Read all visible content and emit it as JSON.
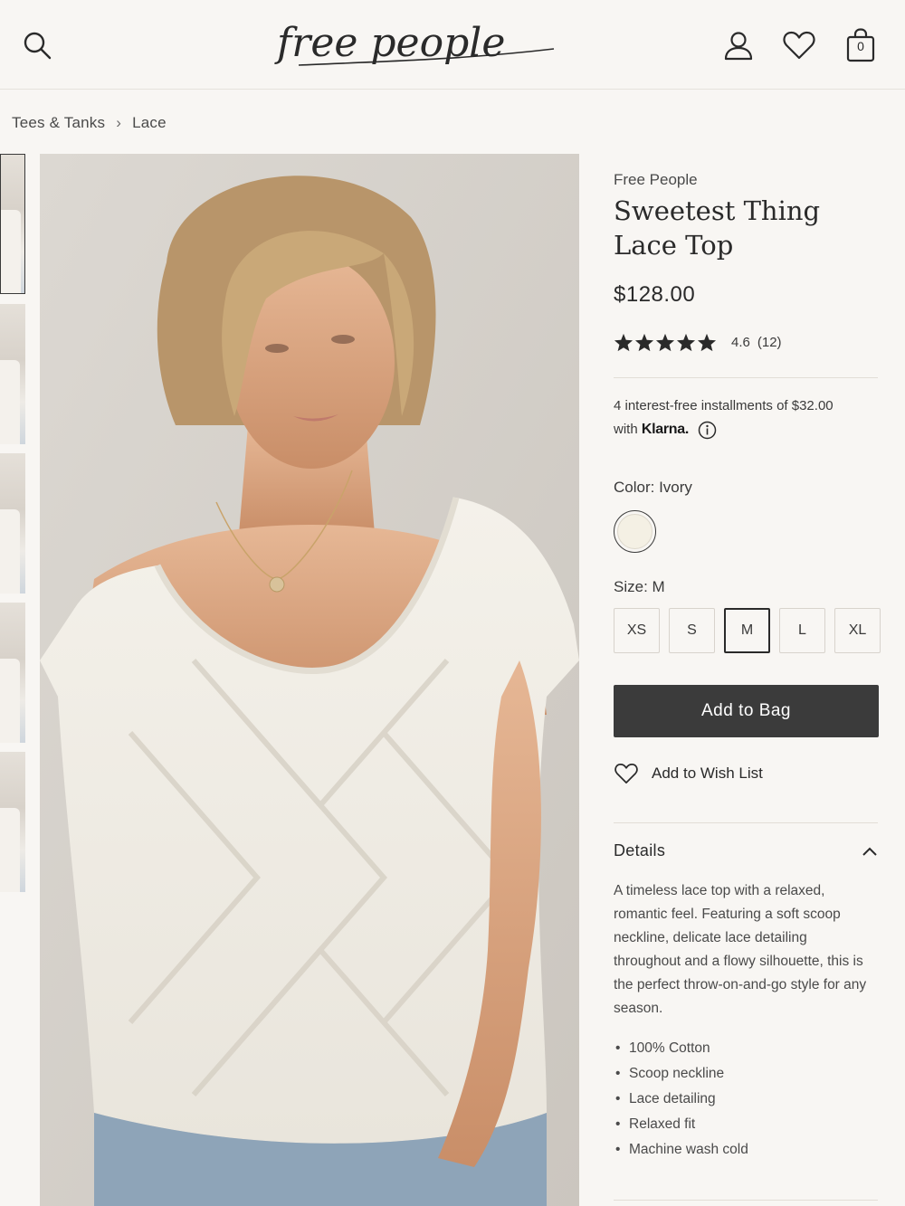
{
  "header": {
    "logo_text": "free people",
    "bag_count": "0"
  },
  "breadcrumb": {
    "items": [
      "Tees & Tanks",
      "Lace"
    ],
    "separator": "›"
  },
  "product": {
    "brand": "Free People",
    "title_line1": "Sweetest Thing",
    "title_line2": "Lace Top",
    "price": "$128.00",
    "rating_value": "4.6",
    "rating_count": "(12)",
    "rating_stars": 5,
    "installments_line1": "4 interest-free installments of $32.00",
    "installments_with": "with",
    "installments_provider": "Klarna.",
    "color_label": "Color: Ivory",
    "color_swatch": "#f4f0e4",
    "size_label": "Size: M",
    "sizes": [
      "XS",
      "S",
      "M",
      "L",
      "XL"
    ],
    "selected_size": "M",
    "add_to_bag": "Add to Bag",
    "add_to_wishlist": "Add to Wish List"
  },
  "details": {
    "title": "Details",
    "description": "A timeless lace top with a relaxed, romantic feel. Featuring a soft scoop neckline, delicate lace detailing throughout and a flowy silhouette, this is the perfect throw-on-and-go style for any season.",
    "bullets": [
      "100% Cotton",
      "Scoop neckline",
      "Lace detailing",
      "Relaxed fit",
      "Machine wash cold"
    ]
  },
  "colors": {
    "button_dark": "#3b3b3b",
    "background": "#f8f6f3",
    "text": "#2a2a2a"
  },
  "icons": [
    "search-icon",
    "account-icon",
    "heart-icon",
    "bag-icon",
    "star-icon",
    "info-icon",
    "chevron-up-icon",
    "chevron-right-icon"
  ]
}
